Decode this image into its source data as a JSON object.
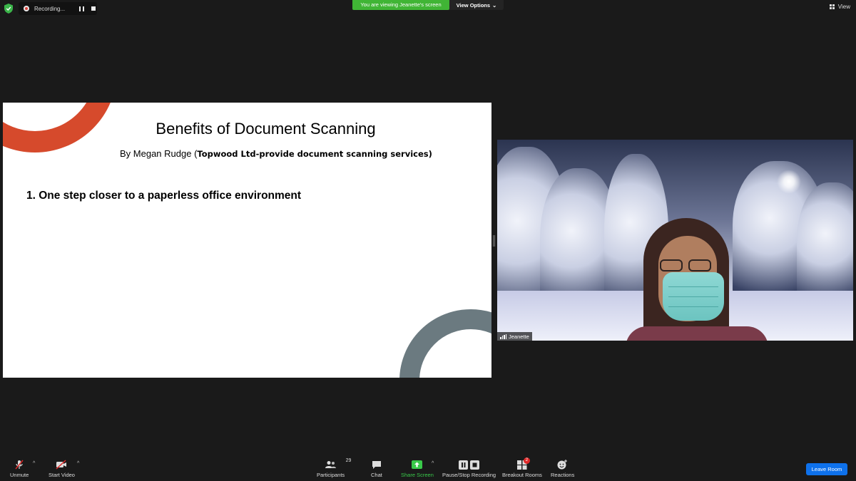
{
  "topbar": {
    "recording_label": "Recording...",
    "viewing_banner": "You are viewing Jeanette's screen",
    "view_options_label": "View Options",
    "view_label": "View"
  },
  "slide": {
    "title": "Benefits of Document Scanning",
    "subtitle_author": "By Megan Rudge (",
    "subtitle_company": "Topwood Ltd-provide document scanning services)",
    "point_1": "1. One step closer to a paperless office environment",
    "accent_colors": {
      "top_arc": "#d64a2c",
      "bottom_arc": "#6b7a80"
    }
  },
  "video": {
    "participant_name": "Jeanette"
  },
  "toolbar": {
    "unmute_label": "Unmute",
    "start_video_label": "Start Video",
    "participants_label": "Participants",
    "participants_count": "29",
    "chat_label": "Chat",
    "share_screen_label": "Share Screen",
    "recording_label": "Pause/Stop Recording",
    "breakout_label": "Breakout Rooms",
    "breakout_badge": "2",
    "reactions_label": "Reactions",
    "leave_label": "Leave Room"
  },
  "colors": {
    "banner_green": "#40b535",
    "share_green": "#39c94a",
    "leave_blue": "#0e71eb",
    "muted_red": "#e02828"
  }
}
